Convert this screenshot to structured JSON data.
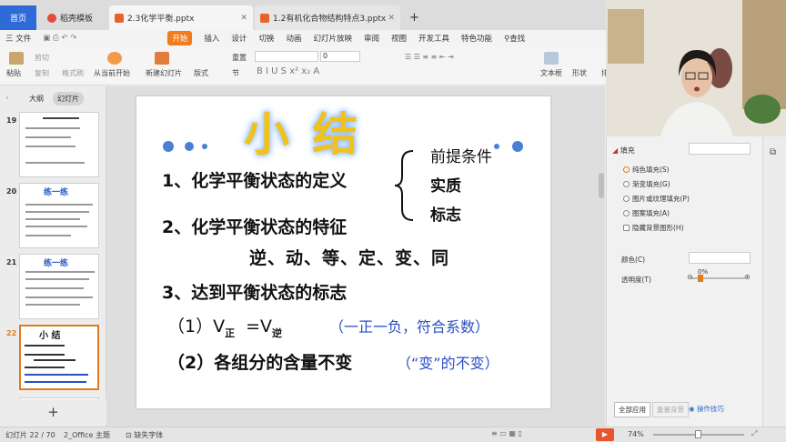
{
  "tabs": {
    "home": "首页",
    "template": "稻壳模板",
    "file1": "2.3化学平衡.pptx",
    "file2": "1.2有机化合物结构特点3.pptx",
    "add": "+"
  },
  "menu": {
    "file": "三 文件",
    "items": [
      "开始",
      "插入",
      "设计",
      "切换",
      "动画",
      "幻灯片放映",
      "审阅",
      "视图",
      "开发工具",
      "特色功能"
    ],
    "search": "查找"
  },
  "ribbon": {
    "paste": "粘贴",
    "cut": "剪切",
    "copy": "复制",
    "format_painter": "格式刷",
    "play_from": "从当前开始",
    "new_slide": "新建幻灯片",
    "layout": "版式",
    "section": "节",
    "reset": "重置",
    "font_size": "0",
    "textbox": "文本框",
    "shape": "形状",
    "arrange": "排列"
  },
  "left_panel": {
    "tab_outline": "大纲",
    "tab_slides": "幻灯片",
    "slide_numbers": [
      "19",
      "20",
      "21",
      "22"
    ],
    "thumb20_title": "练一练",
    "thumb21_title": "练一练",
    "thumb22_title": "小 结",
    "add_button": "+"
  },
  "slide": {
    "title": "小  结",
    "item1": "1、化学平衡状态的定义",
    "brace_items": [
      "前提条件",
      "实质",
      "标志"
    ],
    "item2": "2、化学平衡状态的特征",
    "features": "逆、动、等、定、变、同",
    "item3": "3、达到平衡状态的标志",
    "sub1_prefix": "（1）V",
    "sub1_sub1": "正",
    "sub1_mid": "=V",
    "sub1_sub2": "逆",
    "sub1_note": "（一正一负，符合系数）",
    "sub2_text": "（2）各组分的含量不变",
    "sub2_note": "（“变”的不变）"
  },
  "right_panel": {
    "fill_heading": "填充",
    "options": [
      "纯色填充(S)",
      "渐变填充(G)",
      "图片或纹理填充(P)",
      "图案填充(A)",
      "隐藏背景图形(H)"
    ],
    "color_label": "颜色(C)",
    "transparency_label": "透明度(T)",
    "transparency_value": "0%",
    "apply_all": "全部应用",
    "reset_bg": "重置背景",
    "tips": "操作技巧"
  },
  "status": {
    "slide_count": "幻灯片 22 / 70",
    "theme": "2_Office 主题",
    "missing_font": "缺失字体",
    "zoom": "74%"
  },
  "colors": {
    "accent": "#f07c1e",
    "home_tab": "#2f6ad9",
    "slide_blue_dot": "#4a7fd4",
    "note_blue": "#2b4fc4",
    "title_gold": "#f2c21a"
  }
}
